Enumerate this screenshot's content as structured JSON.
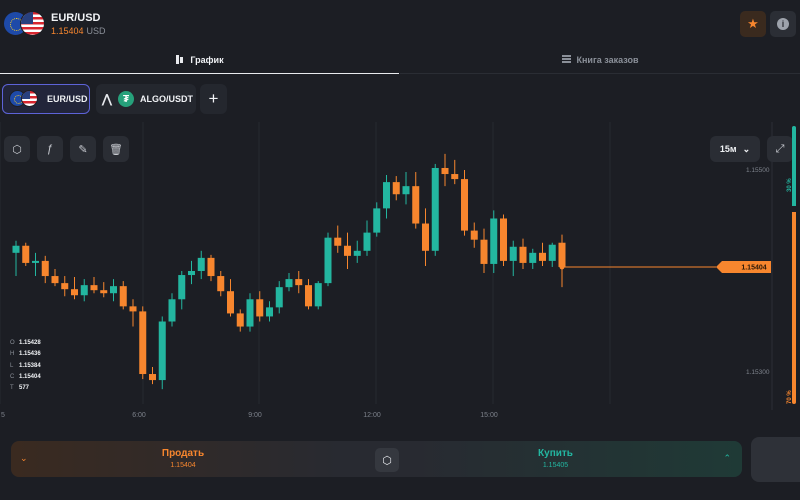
{
  "header": {
    "pair": "EUR/USD",
    "price": "1.15404",
    "unit": "USD",
    "favorite_icon": "star-icon",
    "info_icon": "info-icon"
  },
  "tabs": [
    {
      "label": "График",
      "icon": "chart-icon",
      "active": true
    },
    {
      "label": "Книга заказов",
      "icon": "orderbook-icon",
      "active": false
    }
  ],
  "instruments": [
    {
      "label": "EUR/USD",
      "active": true
    },
    {
      "label": "ALGO/USDT",
      "active": false
    }
  ],
  "add_label": "+",
  "toolbar": {
    "timeframe": "15м"
  },
  "ohlc": {
    "open_key": "O",
    "open": "1.15428",
    "high_key": "H",
    "high": "1.15436",
    "low_key": "L",
    "low": "1.15384",
    "close_key": "C",
    "close": "1.15404",
    "vol_key": "T",
    "vol": "577"
  },
  "sentiment": {
    "up": "30 %",
    "down": "70 %",
    "up_fraction": 0.3
  },
  "chart_data": {
    "type": "candlestick",
    "x_ticks": [
      "6:00",
      "9:00",
      "12:00",
      "15:00"
    ],
    "x_tick_partial": "5",
    "y_ticks": [
      "1.15500",
      "1.15300"
    ],
    "current_price": "1.15404",
    "colors": {
      "up": "#23b6a0",
      "down": "#f7862e"
    },
    "candles": [
      [
        1.15418,
        1.1543,
        1.15395,
        1.15425
      ],
      [
        1.15425,
        1.15428,
        1.15405,
        1.15408
      ],
      [
        1.15408,
        1.15418,
        1.15395,
        1.1541
      ],
      [
        1.1541,
        1.15415,
        1.15388,
        1.15395
      ],
      [
        1.15395,
        1.15402,
        1.15385,
        1.15388
      ],
      [
        1.15388,
        1.15395,
        1.15375,
        1.15382
      ],
      [
        1.15382,
        1.15394,
        1.15372,
        1.15376
      ],
      [
        1.15376,
        1.15392,
        1.1537,
        1.15386
      ],
      [
        1.15386,
        1.15394,
        1.15378,
        1.15381
      ],
      [
        1.15381,
        1.15389,
        1.15374,
        1.15378
      ],
      [
        1.15378,
        1.15392,
        1.1537,
        1.15385
      ],
      [
        1.15385,
        1.1539,
        1.15362,
        1.15365
      ],
      [
        1.15365,
        1.15372,
        1.15345,
        1.1536
      ],
      [
        1.1536,
        1.15365,
        1.15293,
        1.15298
      ],
      [
        1.15298,
        1.15305,
        1.15288,
        1.15292
      ],
      [
        1.15292,
        1.15355,
        1.15283,
        1.1535
      ],
      [
        1.1535,
        1.15378,
        1.15345,
        1.15372
      ],
      [
        1.15372,
        1.154,
        1.15362,
        1.15396
      ],
      [
        1.15396,
        1.1541,
        1.15387,
        1.154
      ],
      [
        1.154,
        1.1542,
        1.15392,
        1.15413
      ],
      [
        1.15413,
        1.15416,
        1.1539,
        1.15395
      ],
      [
        1.15395,
        1.154,
        1.15375,
        1.1538
      ],
      [
        1.1538,
        1.15392,
        1.15355,
        1.15358
      ],
      [
        1.15358,
        1.15362,
        1.1534,
        1.15345
      ],
      [
        1.15345,
        1.15378,
        1.1534,
        1.15372
      ],
      [
        1.15372,
        1.1538,
        1.1535,
        1.15355
      ],
      [
        1.15355,
        1.1537,
        1.1535,
        1.15364
      ],
      [
        1.15364,
        1.1539,
        1.15358,
        1.15384
      ],
      [
        1.15384,
        1.15398,
        1.1538,
        1.15392
      ],
      [
        1.15392,
        1.154,
        1.15378,
        1.15386
      ],
      [
        1.15386,
        1.15392,
        1.15362,
        1.15365
      ],
      [
        1.15365,
        1.1539,
        1.15362,
        1.15388
      ],
      [
        1.15388,
        1.15438,
        1.15385,
        1.15433
      ],
      [
        1.15433,
        1.15445,
        1.15418,
        1.15425
      ],
      [
        1.15425,
        1.15438,
        1.15402,
        1.15415
      ],
      [
        1.15415,
        1.1543,
        1.15408,
        1.1542
      ],
      [
        1.1542,
        1.1545,
        1.15415,
        1.15438
      ],
      [
        1.15438,
        1.15468,
        1.15434,
        1.15462
      ],
      [
        1.15462,
        1.15495,
        1.15452,
        1.15488
      ],
      [
        1.15488,
        1.15494,
        1.1547,
        1.15476
      ],
      [
        1.15476,
        1.15498,
        1.15466,
        1.15484
      ],
      [
        1.15484,
        1.15498,
        1.15442,
        1.15447
      ],
      [
        1.15447,
        1.15462,
        1.15405,
        1.1542
      ],
      [
        1.1542,
        1.15506,
        1.15415,
        1.15502
      ],
      [
        1.15502,
        1.15516,
        1.15484,
        1.15496
      ],
      [
        1.15496,
        1.1551,
        1.15486,
        1.15491
      ],
      [
        1.15491,
        1.155,
        1.15435,
        1.1544
      ],
      [
        1.1544,
        1.15448,
        1.15423,
        1.15431
      ],
      [
        1.15431,
        1.15442,
        1.15398,
        1.15407
      ],
      [
        1.15407,
        1.1546,
        1.15398,
        1.15452
      ],
      [
        1.15452,
        1.15456,
        1.15405,
        1.1541
      ],
      [
        1.1541,
        1.1543,
        1.15395,
        1.15424
      ],
      [
        1.15424,
        1.15432,
        1.15402,
        1.15408
      ],
      [
        1.15408,
        1.15422,
        1.15402,
        1.15418
      ],
      [
        1.15418,
        1.15428,
        1.15405,
        1.1541
      ],
      [
        1.1541,
        1.15428,
        1.15404,
        1.15426
      ],
      [
        1.15428,
        1.15436,
        1.15384,
        1.15404
      ]
    ]
  },
  "trade": {
    "sell_label": "Продать",
    "sell_price": "1.15404",
    "buy_label": "Купить",
    "buy_price": "1.15405"
  }
}
